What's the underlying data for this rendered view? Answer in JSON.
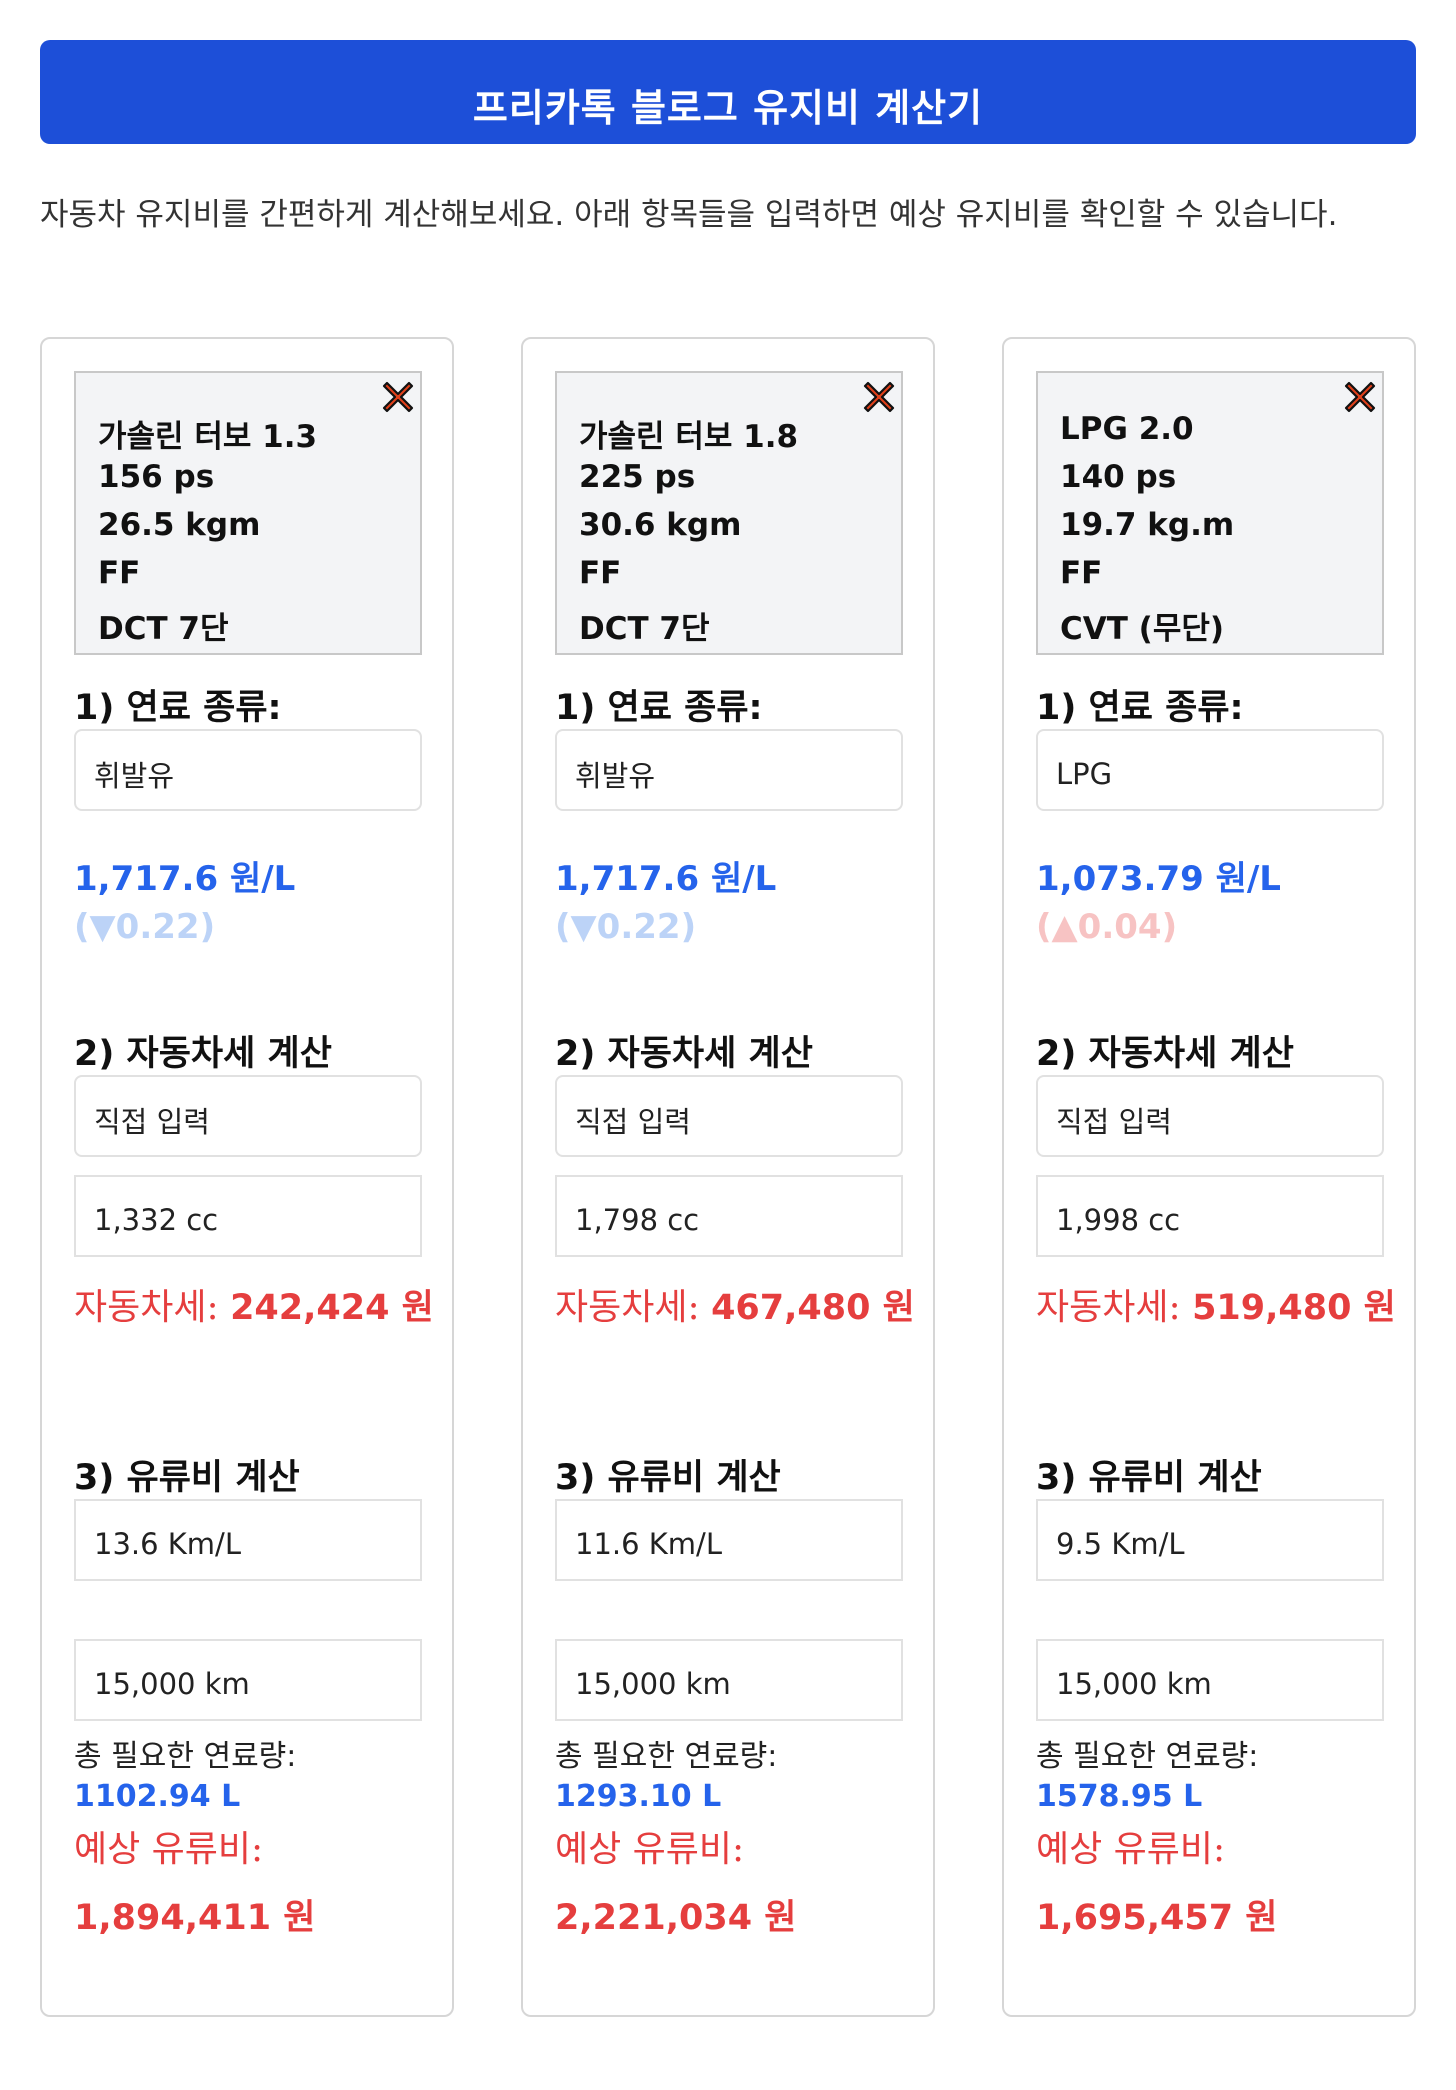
{
  "header": {
    "title": "프리카톡 블로그 유지비 계산기"
  },
  "intro": "자동차 유지비를 간편하게 계산해보세요. 아래 항목들을 입력하면 예상 유지비를 확인할 수 있습니다.",
  "labels": {
    "fuel_type": "1) 연료 종류:",
    "car_tax": "2) 자동차세 계산",
    "fuel_cost": "3) 유류비 계산",
    "total_fuel": "총 필요한 연료량:",
    "expected_cost": "예상 유류비:",
    "tax_prefix": "자동차세: "
  },
  "icons": {
    "close": "close-x-icon",
    "arrow_down": "triangle-down-icon",
    "arrow_up": "triangle-up-icon"
  },
  "colors": {
    "primary": "#1d4fd8",
    "price_blue": "#2563eb",
    "tax_red": "#e53e3e",
    "down_light": "#bcd3f7",
    "up_light": "#f7c3c3"
  },
  "cars": [
    {
      "spec": [
        "가솔린 터보 1.3",
        "156 ps",
        "26.5 kgm",
        "FF",
        "DCT 7단"
      ],
      "fuel_type": "휘발유",
      "price": "1,717.6 원/L",
      "change": "(▼0.22)",
      "change_dir": "down",
      "tax_mode": "직접 입력",
      "displacement": "1,332 cc",
      "tax_amount": "242,424 원",
      "efficiency": "13.6 Km/L",
      "distance": "15,000 km",
      "total_fuel": "1102.94 L",
      "expected_cost": "1,894,411 원"
    },
    {
      "spec": [
        "가솔린 터보 1.8",
        "225 ps",
        "30.6 kgm",
        "FF",
        "DCT 7단"
      ],
      "fuel_type": "휘발유",
      "price": "1,717.6 원/L",
      "change": "(▼0.22)",
      "change_dir": "down",
      "tax_mode": "직접 입력",
      "displacement": "1,798 cc",
      "tax_amount": "467,480 원",
      "efficiency": "11.6 Km/L",
      "distance": "15,000 km",
      "total_fuel": "1293.10 L",
      "expected_cost": "2,221,034 원"
    },
    {
      "spec": [
        "LPG 2.0",
        "140 ps",
        "19.7 kg.m",
        "FF",
        "CVT (무단)"
      ],
      "fuel_type": "LPG",
      "price": "1,073.79 원/L",
      "change": "(▲0.04)",
      "change_dir": "up",
      "tax_mode": "직접 입력",
      "displacement": "1,998 cc",
      "tax_amount": "519,480 원",
      "efficiency": "9.5 Km/L",
      "distance": "15,000 km",
      "total_fuel": "1578.95 L",
      "expected_cost": "1,695,457 원"
    }
  ]
}
